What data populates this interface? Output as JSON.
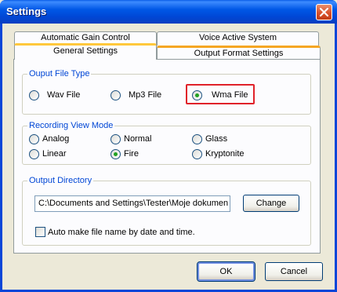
{
  "window": {
    "title": "Settings"
  },
  "tabs": {
    "row_top": [
      {
        "label": "Automatic Gain Control"
      },
      {
        "label": "Voice Active System"
      }
    ],
    "row_bottom": [
      {
        "label": "General Settings"
      },
      {
        "label": "Output Format Settings"
      }
    ]
  },
  "output_file_type": {
    "legend": "Ouput File Type",
    "options": [
      {
        "label": "Wav File",
        "selected": false
      },
      {
        "label": "Mp3 File",
        "selected": false
      },
      {
        "label": "Wma File",
        "selected": true
      }
    ],
    "highlight_color": "#e0222a"
  },
  "recording_view_mode": {
    "legend": "Recording View Mode",
    "options": [
      {
        "label": "Analog",
        "selected": false
      },
      {
        "label": "Normal",
        "selected": false
      },
      {
        "label": "Glass",
        "selected": false
      },
      {
        "label": "Linear",
        "selected": false
      },
      {
        "label": "Fire",
        "selected": true
      },
      {
        "label": "Kryptonite",
        "selected": false
      }
    ]
  },
  "output_directory": {
    "legend": "Output Directory",
    "path": "C:\\Documents and Settings\\Tester\\Moje dokumen",
    "change_label": "Change",
    "auto_name_label": "Auto make file name by date and time.",
    "auto_name_checked": false
  },
  "buttons": {
    "ok": "OK",
    "cancel": "Cancel"
  },
  "colors": {
    "title_bar": "#0058e6",
    "legend_text": "#0046d5",
    "selected_dot": "#21a121"
  }
}
